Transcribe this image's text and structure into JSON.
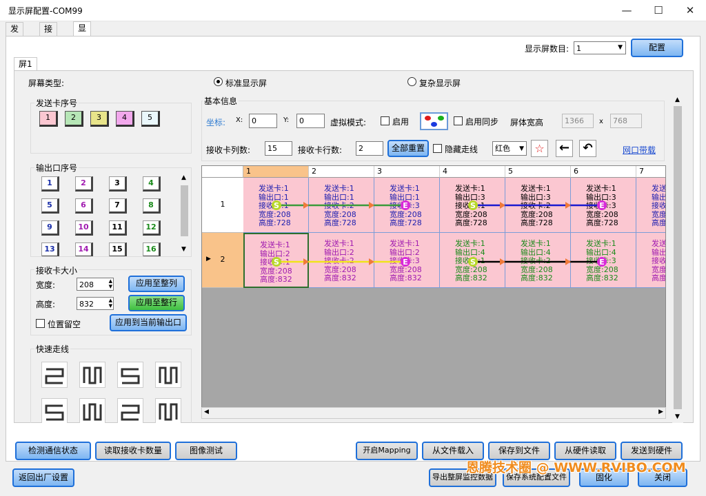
{
  "window": {
    "title": "显示屏配置-COM99",
    "minimize": "—",
    "maximize": "☐",
    "close": "✕"
  },
  "tabs": [
    "发送卡",
    "接收卡",
    "显示屏连接"
  ],
  "display_count_label": "显示屏数目:",
  "display_count_value": "1",
  "config_button": "配置",
  "screen_tab": "屏1",
  "screen_type_label": "屏幕类型:",
  "radio_standard": "标准显示屏",
  "radio_complex": "复杂显示屏",
  "send_card_group": "发送卡序号",
  "send_cards": [
    {
      "n": "1",
      "color": "#fbc7d1"
    },
    {
      "n": "2",
      "color": "#b6e6b6"
    },
    {
      "n": "3",
      "color": "#e8e48a"
    },
    {
      "n": "4",
      "color": "#f2a8ec"
    },
    {
      "n": "5",
      "color": "#eaf7fb"
    }
  ],
  "output_group": "输出口序号",
  "outputs": [
    {
      "n": "1",
      "color": "#1a2ea8"
    },
    {
      "n": "2",
      "color": "#a01ab0"
    },
    {
      "n": "3",
      "color": "#000"
    },
    {
      "n": "4",
      "color": "#1a8a1a"
    },
    {
      "n": "5",
      "color": "#1a2ea8"
    },
    {
      "n": "6",
      "color": "#a01ab0"
    },
    {
      "n": "7",
      "color": "#000"
    },
    {
      "n": "8",
      "color": "#1a8a1a"
    },
    {
      "n": "9",
      "color": "#1a2ea8"
    },
    {
      "n": "10",
      "color": "#a01ab0"
    },
    {
      "n": "11",
      "color": "#000"
    },
    {
      "n": "12",
      "color": "#1a8a1a"
    },
    {
      "n": "13",
      "color": "#1a2ea8"
    },
    {
      "n": "14",
      "color": "#a01ab0"
    },
    {
      "n": "15",
      "color": "#000"
    },
    {
      "n": "16",
      "color": "#1a8a1a"
    }
  ],
  "receiver_size_group": "接收卡大小",
  "width_label": "宽度:",
  "width_value": "208",
  "height_label": "高度:",
  "height_value": "832",
  "apply_col": "应用至整列",
  "apply_row": "应用至整行",
  "reserve_label": "位置留空",
  "apply_current": "应用到当前输出口",
  "quick_group": "快速走线",
  "basic_info": "基本信息",
  "coord_label": "坐标:",
  "x_label": "X:",
  "x_value": "0",
  "y_label": "Y:",
  "y_value": "0",
  "virtual_mode": "虚拟模式:",
  "enable": "启用",
  "enable_sync": "启用同步",
  "screen_wh_label": "屏体宽高",
  "screen_w": "1366",
  "screen_h": "768",
  "x_sep": "x",
  "cols_label": "接收卡列数:",
  "cols_value": "15",
  "rows_label": "接收卡行数:",
  "rows_value": "2",
  "reset_all": "全部重置",
  "hide_route": "隐藏走线",
  "color_value": "红色",
  "port_bandwidth": "网口带载",
  "col_headers": [
    "1",
    "2",
    "3",
    "4",
    "5",
    "6",
    "7"
  ],
  "row_headers": [
    "1",
    "2"
  ],
  "cells": [
    [
      {
        "l1": "发送卡:1",
        "l2": "输出口:1",
        "l3": "接收卡:1",
        "l4": "宽度:208",
        "l5": "高度:728",
        "c": "#2020b0"
      },
      {
        "l1": "发送卡:1",
        "l2": "输出口:1",
        "l3": "接收卡:2",
        "l4": "宽度:208",
        "l5": "高度:728",
        "c": "#2020b0"
      },
      {
        "l1": "发送卡:1",
        "l2": "输出口:1",
        "l3": "接收卡:3",
        "l4": "宽度:208",
        "l5": "高度:728",
        "c": "#2020b0"
      },
      {
        "l1": "发送卡:1",
        "l2": "输出口:3",
        "l3": "接收卡:1",
        "l4": "宽度:208",
        "l5": "高度:728",
        "c": "#000"
      },
      {
        "l1": "发送卡:1",
        "l2": "输出口:3",
        "l3": "接收卡:2",
        "l4": "宽度:208",
        "l5": "高度:728",
        "c": "#000"
      },
      {
        "l1": "发送卡:1",
        "l2": "输出口:3",
        "l3": "接收卡:3",
        "l4": "宽度:208",
        "l5": "高度:728",
        "c": "#000"
      },
      {
        "l1": "发送",
        "l2": "输出",
        "l3": "接收",
        "l4": "宽度",
        "l5": "高度",
        "c": "#2020b0"
      }
    ],
    [
      {
        "l1": "发送卡:1",
        "l2": "输出口:2",
        "l3": "接收卡:1",
        "l4": "宽度:208",
        "l5": "高度:832",
        "c": "#a01ab0"
      },
      {
        "l1": "发送卡:1",
        "l2": "输出口:2",
        "l3": "接收卡:2",
        "l4": "宽度:208",
        "l5": "高度:832",
        "c": "#a01ab0"
      },
      {
        "l1": "发送卡:1",
        "l2": "输出口:2",
        "l3": "接收卡:3",
        "l4": "宽度:208",
        "l5": "高度:832",
        "c": "#a01ab0"
      },
      {
        "l1": "发送卡:1",
        "l2": "输出口:4",
        "l3": "接收卡:1",
        "l4": "宽度:208",
        "l5": "高度:832",
        "c": "#1a8a1a"
      },
      {
        "l1": "发送卡:1",
        "l2": "输出口:4",
        "l3": "接收卡:2",
        "l4": "宽度:208",
        "l5": "高度:832",
        "c": "#1a8a1a"
      },
      {
        "l1": "发送卡:1",
        "l2": "输出口:4",
        "l3": "接收卡:3",
        "l4": "宽度:208",
        "l5": "高度:832",
        "c": "#1a8a1a"
      },
      {
        "l1": "发送",
        "l2": "输出",
        "l3": "接收",
        "l4": "宽度",
        "l5": "高度",
        "c": "#a01ab0"
      }
    ]
  ],
  "bottom_buttons": {
    "detect": "检测通信状态",
    "read_count": "读取接收卡数量",
    "image_test": "图像测试",
    "mapping": "开启Mapping",
    "load_file": "从文件载入",
    "save_file": "保存到文件",
    "read_hw": "从硬件读取",
    "send_hw": "发送到硬件",
    "factory": "返回出厂设置",
    "export": "导出整屏监控数据",
    "save_sys": "保存系统配置文件",
    "solidify": "固化",
    "close": "关闭"
  },
  "watermark": "恩腾技术圈 @ WWW.RVIBO.COM"
}
